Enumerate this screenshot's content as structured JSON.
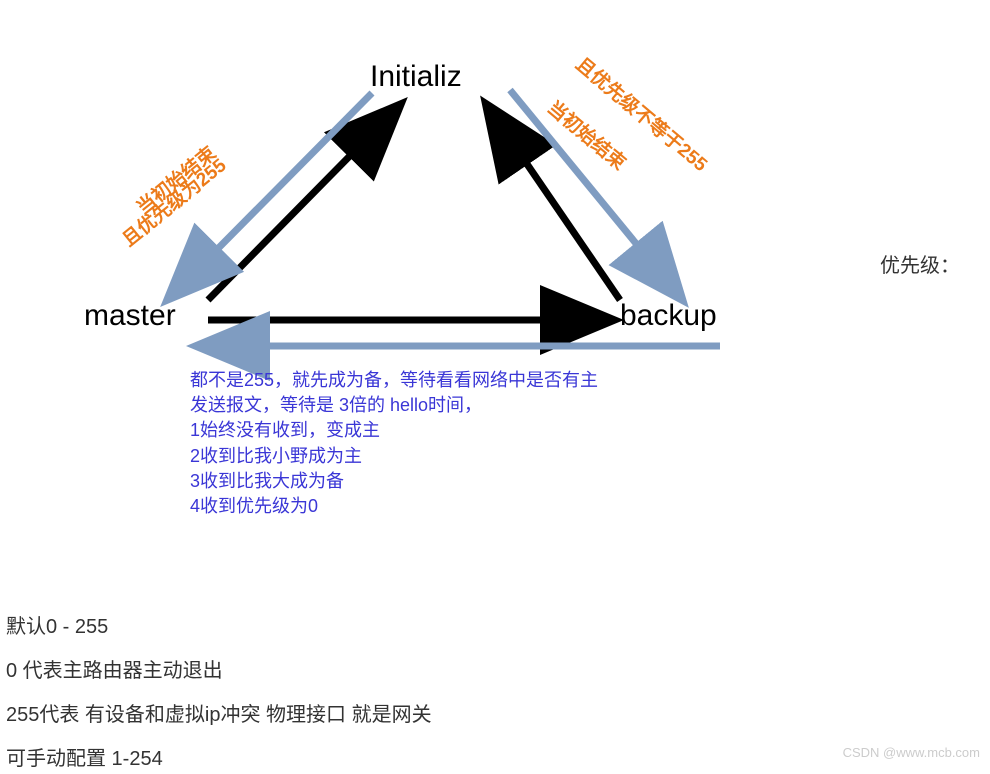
{
  "nodes": {
    "init": "Initializ",
    "master": "master",
    "backup": "backup"
  },
  "edges": {
    "left_l1": "当初始结束",
    "left_l2": "且优先级为255",
    "right_l1": "当初始结束",
    "right_l2": "且优先级不等于255"
  },
  "blue_lines": [
    "都不是255，就先成为备，等待看看网络中是否有主",
    "发送报文，等待是 3倍的 hello时间，",
    "1始终没有收到，变成主",
    "2收到比我小野成为主",
    "3收到比我大成为备",
    "4收到优先级为0"
  ],
  "side_label": "优先级：",
  "bottom": {
    "l1": "默认0 - 255",
    "l2": "0 代表主路由器主动退出",
    "l3": "255代表   有设备和虚拟ip冲突     物理接口   就是网关",
    "l4": "可手动配置   1-254"
  },
  "watermark": "CSDN @www.mcb.com",
  "colors": {
    "black": "#000000",
    "steel": "#7f9cc1",
    "orange": "#ec7b1a",
    "blueText": "#3a36d6"
  }
}
